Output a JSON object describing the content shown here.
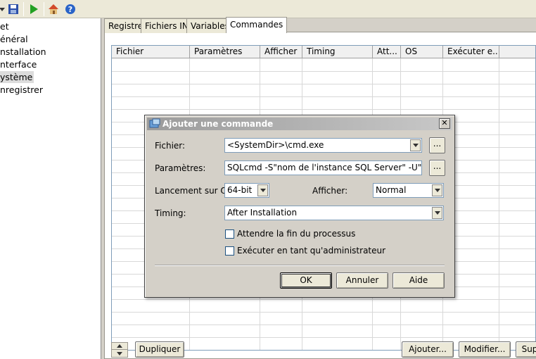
{
  "toolbar": {
    "icons": [
      "dropdown-arrow-icon",
      "save-icon",
      "run-icon",
      "home-icon",
      "help-icon"
    ]
  },
  "tree": {
    "items": [
      {
        "label": "et"
      },
      {
        "label": "énéral"
      },
      {
        "label": "nstallation"
      },
      {
        "label": "nterface"
      },
      {
        "label": "ystème",
        "selected": true
      },
      {
        "label": "nregistrer"
      }
    ]
  },
  "tabs": [
    {
      "label": "Registre"
    },
    {
      "label": "Fichiers INI"
    },
    {
      "label": "Variables"
    },
    {
      "label": "Commandes",
      "active": true
    }
  ],
  "grid": {
    "columns": [
      "Fichier",
      "Paramètres",
      "Afficher",
      "Timing",
      "Att...",
      "OS",
      "Exécuter e..."
    ]
  },
  "bottom_buttons": {
    "duplicate": "Dupliquer",
    "add": "Ajouter...",
    "modify": "Modifier...",
    "delete": "Sup"
  },
  "dialog": {
    "title": "Ajouter une commande",
    "close": "✕",
    "file_label": "Fichier:",
    "file_value": "<SystemDir>\\cmd.exe",
    "browse": "...",
    "params_label": "Paramètres:",
    "params_value": "SQLcmd -S\"nom de l'instance SQL Server\" -U\"nom de conn",
    "os_label": "Lancement sur OS:",
    "os_value": "64-bit",
    "show_label": "Afficher:",
    "show_value": "Normal",
    "timing_label": "Timing:",
    "timing_value": "After Installation",
    "wait_label": "Attendre la fin du processus",
    "admin_label": "Exécuter en tant qu'administrateur",
    "ok": "OK",
    "cancel": "Annuler",
    "help": "Aide"
  }
}
